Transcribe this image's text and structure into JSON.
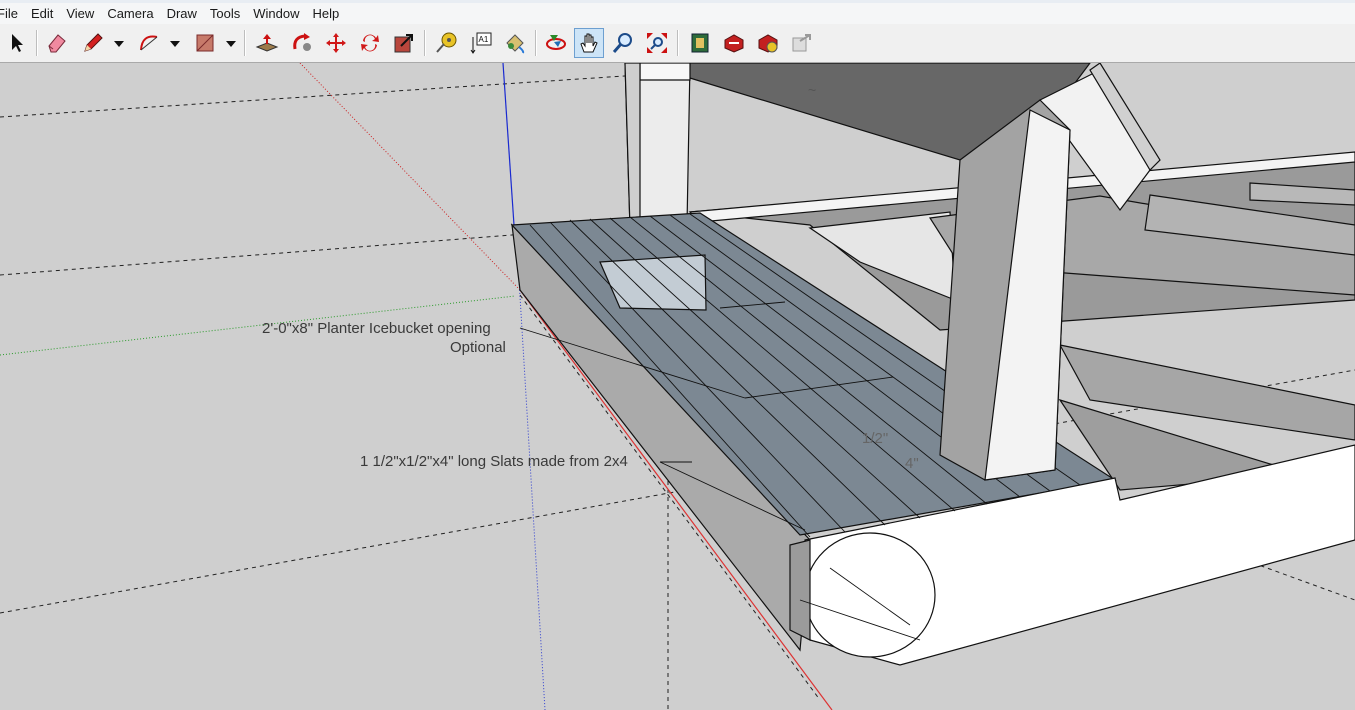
{
  "menu": [
    "File",
    "Edit",
    "View",
    "Camera",
    "Draw",
    "Tools",
    "Window",
    "Help"
  ],
  "toolbar": {
    "tools": [
      {
        "name": "select-tool",
        "icon": "arrow-cursor-icon"
      },
      {
        "name": "eraser-tool",
        "icon": "eraser-icon"
      },
      {
        "name": "line-tool",
        "icon": "pencil-icon"
      },
      {
        "name": "arc-tool",
        "icon": "arc-icon"
      },
      {
        "name": "shape-tool",
        "icon": "rectangle-icon"
      },
      {
        "name": "push-pull-tool",
        "icon": "push-pull-icon"
      },
      {
        "name": "follow-me-tool",
        "icon": "follow-me-icon"
      },
      {
        "name": "move-tool",
        "icon": "move-arrows-icon"
      },
      {
        "name": "rotate-tool",
        "icon": "rotate-icon"
      },
      {
        "name": "scale-tool",
        "icon": "scale-icon"
      },
      {
        "name": "tape-measure-tool",
        "icon": "tape-measure-icon"
      },
      {
        "name": "text-tool",
        "icon": "text-a1-icon"
      },
      {
        "name": "paint-bucket-tool",
        "icon": "paint-bucket-icon"
      },
      {
        "name": "orbit-tool",
        "icon": "orbit-icon"
      },
      {
        "name": "pan-tool",
        "icon": "hand-icon"
      },
      {
        "name": "zoom-tool",
        "icon": "magnifier-icon"
      },
      {
        "name": "zoom-extents-tool",
        "icon": "zoom-extents-icon"
      },
      {
        "name": "warehouse-tool",
        "icon": "warehouse-icon"
      },
      {
        "name": "share-model-tool",
        "icon": "share-model-icon"
      },
      {
        "name": "extension-warehouse-tool",
        "icon": "extension-icon"
      },
      {
        "name": "send-to-layout-tool",
        "icon": "layout-icon"
      }
    ],
    "active": "pan-tool"
  },
  "labels": {
    "planter_line1": "2'-0\"x8\" Planter Icebucket opening",
    "planter_line2": "Optional",
    "slats": "1 1/2\"x1/2\"x4\" long Slats made from 2x4",
    "dim_half": "1/2\"",
    "dim_four": "4\"",
    "tilde": "~"
  }
}
